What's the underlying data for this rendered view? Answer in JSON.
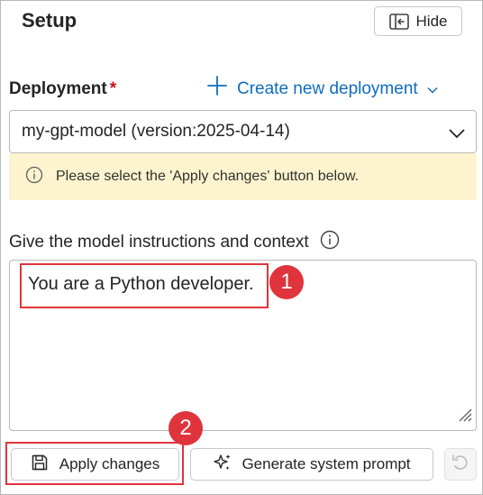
{
  "header": {
    "title": "Setup",
    "hide_label": "Hide"
  },
  "deployment": {
    "label": "Deployment",
    "required_mark": "*",
    "create_link": "Create new deployment",
    "selected": "my-gpt-model (version:2025-04-14)"
  },
  "notice": {
    "text": "Please select the 'Apply changes' button below."
  },
  "instructions": {
    "label": "Give the model instructions and context",
    "value": "You are a Python developer."
  },
  "annotations": {
    "step1": "1",
    "step2": "2"
  },
  "actions": {
    "apply_label": "Apply changes",
    "generate_label": "Generate system prompt"
  },
  "colors": {
    "accent": "#0f6cbd",
    "highlight": "#e0343c",
    "notice_bg": "#fdf4cf",
    "required": "#c50f1f"
  }
}
